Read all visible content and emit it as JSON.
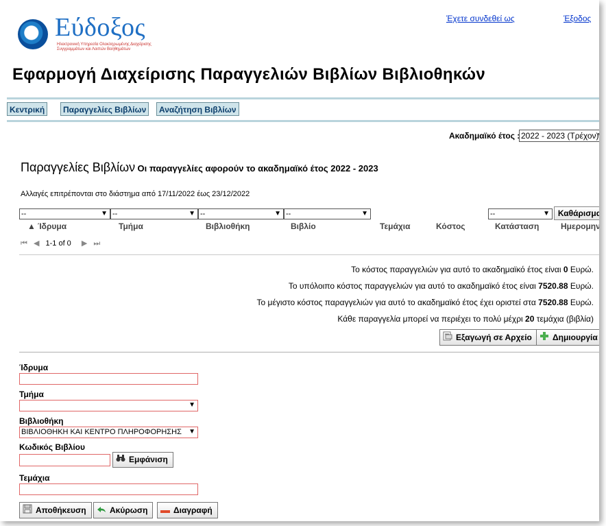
{
  "header": {
    "logo_text": "Εύδοξος",
    "logo_subtitle_line1": "Ηλεκτρονική Υπηρεσία Ολοκληρωμένης Διαχείρισης",
    "logo_subtitle_line2": "Συγγραμμάτων και Λοιπών Βοηθημάτων",
    "logged_in_link": "Έχετε συνδεθεί ως",
    "logout_link": "Έξοδος",
    "app_title": "Εφαρμογή Διαχείρισης Παραγγελιών Βιβλίων Βιβλιοθηκών"
  },
  "menu": {
    "items": [
      {
        "label": "Κεντρική"
      },
      {
        "label": "Παραγγελίες Βιβλίων"
      },
      {
        "label": "Αναζήτηση Βιβλίων"
      }
    ]
  },
  "year_selector": {
    "label": "Ακαδημαϊκό έτος :",
    "value": "2022 - 2023 (Τρέχον)"
  },
  "orders": {
    "title": "Παραγγελίες Βιβλίων",
    "subtitle": "Οι παραγγελίες αφορούν το ακαδημαϊκό έτος 2022 - 2023",
    "changes_note": "Αλλαγές επιτρέπονται στο διάστημα από 17/11/2022 έως 23/12/2022",
    "filters": {
      "institution": "--",
      "department": "--",
      "library": "--",
      "status": "--",
      "clear_label": "Καθάρισμα"
    },
    "columns": [
      "Ίδρυμα",
      "Τμήμα",
      "Βιβλιοθήκη",
      "Βιβλίο",
      "Τεμάχια",
      "Κόστος",
      "Κατάσταση",
      "Ημερομηνία"
    ],
    "sort_indicator": "▲",
    "pager": {
      "first": "⏮",
      "prev": "◀",
      "range": "1-1 of 0",
      "next": "▶",
      "last": "⏭"
    }
  },
  "summary": {
    "cost_prefix": "Το κόστος παραγγελιών για αυτό το ακαδημαϊκό έτος είναι",
    "cost_value": "0",
    "cost_suffix": "Ευρώ.",
    "remaining_prefix": "Το υπόλοιπο κόστος παραγγελιών για αυτό το ακαδημαϊκό έτος είναι",
    "remaining_value": "7520.88",
    "remaining_suffix": "Ευρώ.",
    "max_prefix": "Το μέγιστο κόστος παραγγελιών για αυτό το ακαδημαϊκό έτος έχει οριστεί στα",
    "max_value": "7520.88",
    "max_suffix": "Ευρώ.",
    "limit_prefix": "Κάθε παραγγελία μπορεί να περιέχει το πολύ μέχρι",
    "limit_value": "20",
    "limit_suffix": "τεμάχια (βιβλία)",
    "export_label": "Εξαγωγή σε Αρχείο",
    "create_label": "Δημιουργία"
  },
  "form": {
    "institution_label": "Ίδρυμα",
    "institution_value": "",
    "department_label": "Τμήμα",
    "department_value": "",
    "library_label": "Βιβλιοθήκη",
    "library_value": "ΒΙΒΛΙΟΘΗΚΗ ΚΑΙ ΚΕΝΤΡΟ ΠΛΗΡΟΦΟΡΗΣΗΣ",
    "book_code_label": "Κωδικός Βιβλίου",
    "book_code_value": "",
    "show_label": "Εμφάνιση",
    "quantity_label": "Τεμάχια",
    "quantity_value": "",
    "save_label": "Αποθήκευση",
    "cancel_label": "Ακύρωση",
    "delete_label": "Διαγραφή"
  },
  "colors": {
    "menu_bg": "#cfe4ea",
    "menu_border": "#b9d4dc",
    "required_border": "#e06666",
    "link": "#0033cc",
    "logo_blue": "#1f6fc4"
  }
}
